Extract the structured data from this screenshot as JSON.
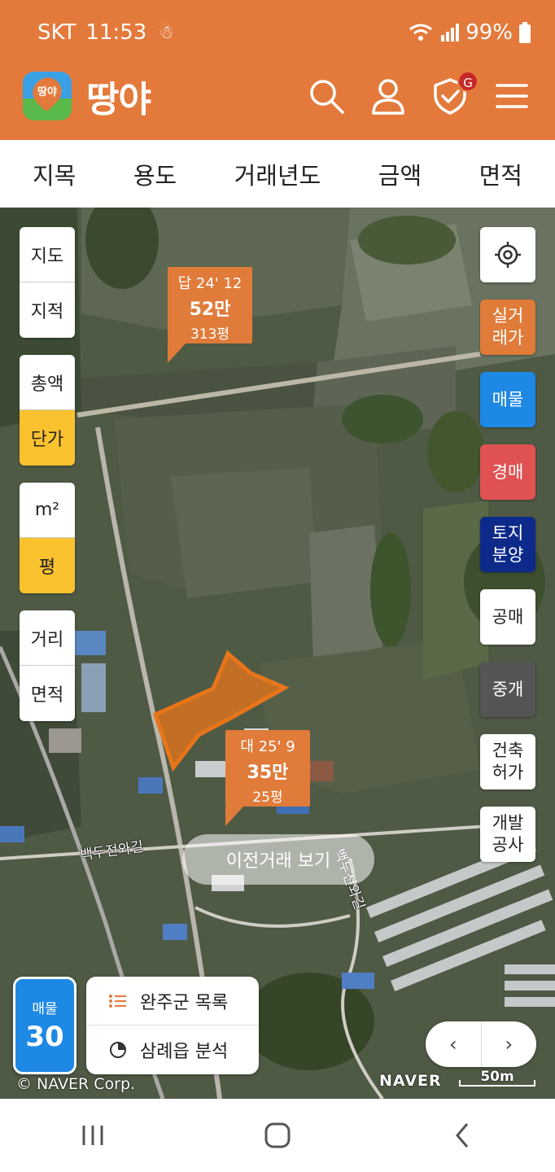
{
  "status_bar": {
    "carrier": "SKT",
    "time": "11:53",
    "battery": "99%"
  },
  "header": {
    "app_name": "땅야",
    "logo_text": "땅야",
    "notification_badge": "G"
  },
  "filters": [
    "지목",
    "용도",
    "거래년도",
    "금액",
    "면적"
  ],
  "map_controls_left": {
    "map_type": [
      "지도",
      "지적"
    ],
    "price_mode": [
      "총액",
      "단가"
    ],
    "price_mode_active": "단가",
    "unit": [
      "m²",
      "평"
    ],
    "unit_active": "평",
    "measure": [
      "거리",
      "면적"
    ]
  },
  "map_controls_right": [
    {
      "label": "실거\n래가",
      "bg": "#E07B3A",
      "color": "#ffffff"
    },
    {
      "label": "매물",
      "bg": "#1E88E5",
      "color": "#ffffff"
    },
    {
      "label": "경매",
      "bg": "#E05252",
      "color": "#ffffff"
    },
    {
      "label": "토지\n분양",
      "bg": "#0D2A8A",
      "color": "#ffffff"
    },
    {
      "label": "공매",
      "bg": "#ffffff",
      "color": "#222222"
    },
    {
      "label": "중개",
      "bg": "#555555",
      "color": "#ffffff"
    },
    {
      "label": "건축\n허가",
      "bg": "#ffffff",
      "color": "#222222"
    },
    {
      "label": "개발\n공사",
      "bg": "#ffffff",
      "color": "#222222"
    }
  ],
  "price_markers": [
    {
      "line1": "답 24' 12",
      "price": "52만",
      "area": "313평"
    },
    {
      "line1": "대 25' 9",
      "price": "35만",
      "area": "25평"
    }
  ],
  "road_labels": [
    "백두전와길",
    "백두전와길"
  ],
  "prev_trade_button": "이전거래 보기",
  "listing_count": {
    "label": "매물",
    "count": "30"
  },
  "bottom_panel": {
    "list_label": "완주군 목록",
    "analysis_label": "삼례읍 분석"
  },
  "map_attribution": "© NAVER Corp.",
  "naver_logo": "NAVER",
  "scale_label": "50m",
  "colors": {
    "brand_orange": "#E37A3C",
    "active_yellow": "#F9C22E",
    "parcel_orange": "#E8751A"
  }
}
